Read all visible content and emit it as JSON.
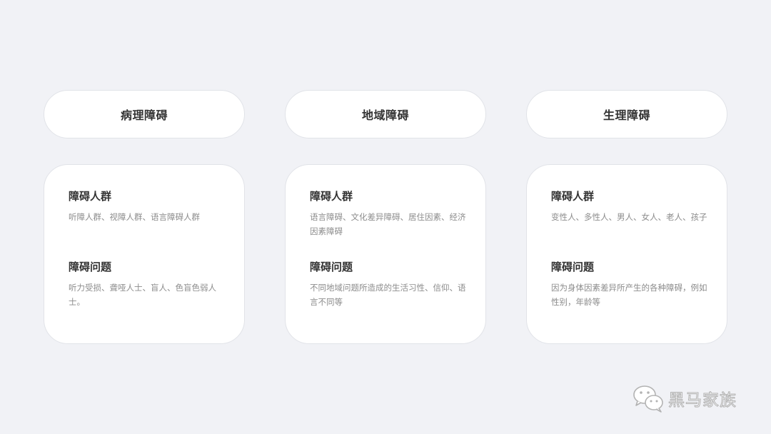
{
  "columns": [
    {
      "title": "病理障碍",
      "sections": [
        {
          "heading": "障碍人群",
          "body": "听障人群、视障人群、语言障碍人群"
        },
        {
          "heading": "障碍问题",
          "body": "听力受损、聋哑人士、盲人、色盲色弱人士。"
        }
      ]
    },
    {
      "title": "地域障碍",
      "sections": [
        {
          "heading": "障碍人群",
          "body": "语言障碍、文化差异障碍、居住因素、经济因素障碍"
        },
        {
          "heading": "障碍问题",
          "body": "不同地域问题所造成的生活习性、信仰、语言不同等"
        }
      ]
    },
    {
      "title": "生理障碍",
      "sections": [
        {
          "heading": "障碍人群",
          "body": "变性人、多性人、男人、女人、老人、孩子"
        },
        {
          "heading": "障碍问题",
          "body": "因为身体因素差异所产生的各种障碍，例如性别，年龄等"
        }
      ]
    }
  ],
  "watermark": {
    "icon": "wechat-icon",
    "text": "黑马家族"
  },
  "colors": {
    "background": "#f1f2f6",
    "card": "#ffffff",
    "border": "#e1e3e8",
    "heading": "#333333",
    "body_text": "#8c8c8c"
  }
}
